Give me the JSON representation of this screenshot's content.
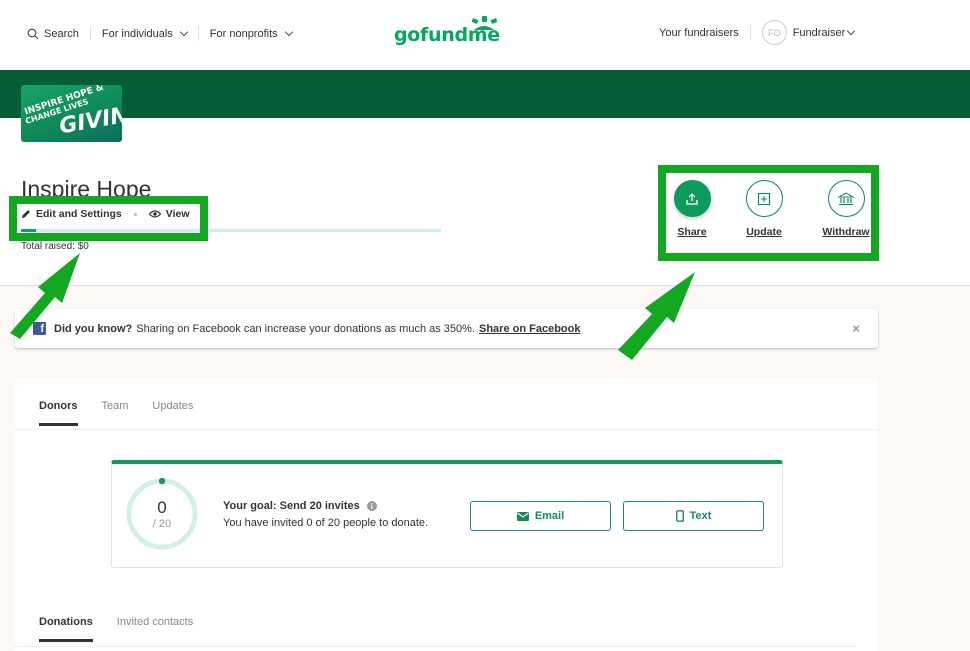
{
  "header": {
    "search_label": "Search",
    "nav_individuals": "For individuals",
    "nav_nonprofits": "For nonprofits",
    "logo_text": "gofundme",
    "your_fundraisers": "Your fundraisers",
    "avatar_initials": "FO",
    "user_menu": "Fundraiser"
  },
  "cover": {
    "line1": "INSPIRE HOPE &",
    "line2": "CHANGE LIVES",
    "line3": "GIVING"
  },
  "campaign": {
    "title": "Inspire Hope",
    "edit_label": "Edit and Settings",
    "view_label": "View",
    "total_raised": "Total raised: $0",
    "progress_fraction": 0.0
  },
  "actions": [
    {
      "label": "Share",
      "icon": "share-upload-icon"
    },
    {
      "label": "Update",
      "icon": "plus-square-icon"
    },
    {
      "label": "Withdraw",
      "icon": "bank-icon"
    }
  ],
  "notice": {
    "bold": "Did you know?",
    "text": "Sharing on Facebook can increase your donations as much as 350%.",
    "link": "Share on Facebook",
    "close": "×"
  },
  "tabs": [
    {
      "label": "Donors",
      "active": true
    },
    {
      "label": "Team",
      "active": false
    },
    {
      "label": "Updates",
      "active": false
    }
  ],
  "goal": {
    "count": "0",
    "total": "/ 20",
    "invited": 0,
    "target": 20,
    "title": "Your goal: Send 20 invites",
    "subtitle": "You have invited 0 of 20 people to donate.",
    "email_button": "Email",
    "text_button": "Text"
  },
  "subtabs": [
    {
      "label": "Donations",
      "active": true
    },
    {
      "label": "Invited contacts",
      "active": false
    }
  ],
  "colors": {
    "brand_green": "#02a95c",
    "banner_green": "#055e36",
    "annotation_green": "#14a722",
    "facebook_blue": "#3b5998"
  }
}
